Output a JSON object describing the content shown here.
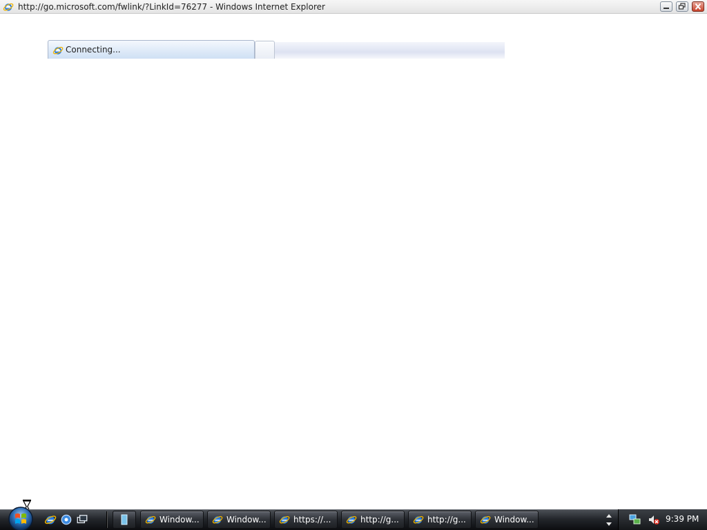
{
  "window": {
    "title": "http://go.microsoft.com/fwlink/?LinkId=76277 - Windows Internet Explorer",
    "icon": "internet-explorer-icon",
    "controls": [
      "minimize",
      "restore",
      "close"
    ]
  },
  "tabs": {
    "active_label": "Connecting...",
    "active_icon": "internet-explorer-icon",
    "new_tab_icon": "new-tab"
  },
  "taskbar": {
    "quick_launch": [
      "internet-explorer-icon",
      "ie-settings-icon",
      "switch-windows-icon"
    ],
    "buttons": [
      {
        "label": "Window...",
        "icon": "internet-explorer-icon"
      },
      {
        "label": "Window...",
        "icon": "internet-explorer-icon"
      },
      {
        "label": "https://...",
        "icon": "internet-explorer-icon"
      },
      {
        "label": "http://g...",
        "icon": "internet-explorer-icon"
      },
      {
        "label": "http://g...",
        "icon": "internet-explorer-icon"
      },
      {
        "label": "Window...",
        "icon": "internet-explorer-icon"
      }
    ],
    "tray_icons": [
      "network-icon",
      "volume-muted-icon"
    ],
    "clock": "9:39 PM"
  },
  "colors": {
    "taskbar": "#1e2024",
    "ie_blue": "#1f6fd1",
    "ie_ring": "#f0b400"
  }
}
